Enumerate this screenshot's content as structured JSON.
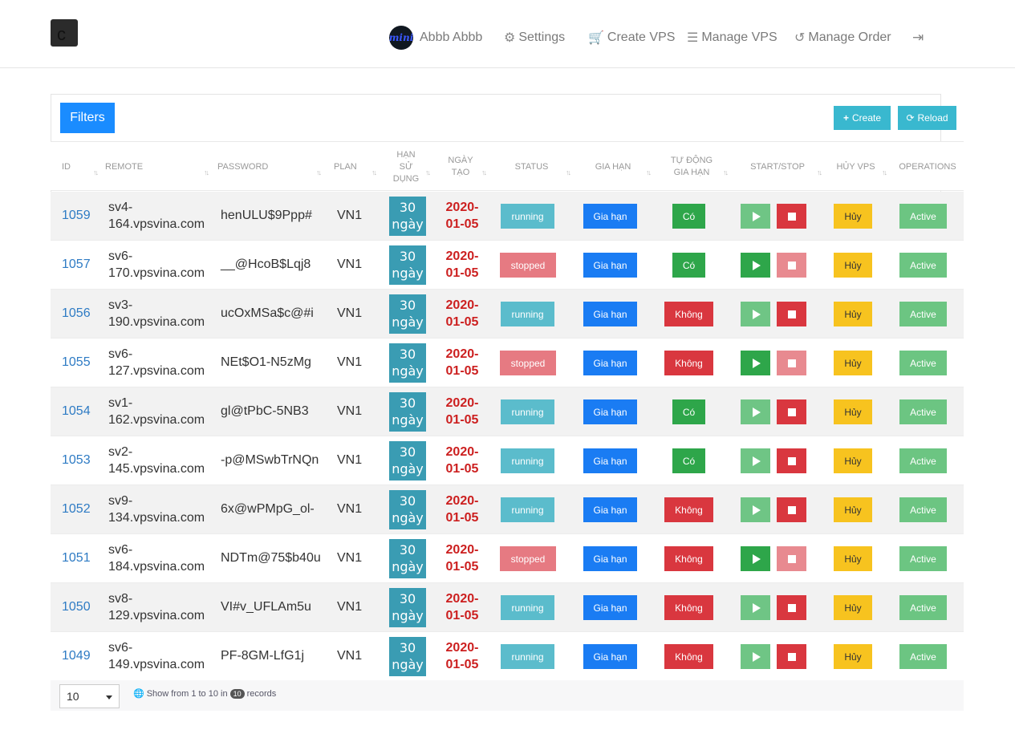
{
  "brand": {
    "logo_letter": "c"
  },
  "nav": {
    "user_name": "Abbb Abbb",
    "avatar_text": "mini",
    "settings": "Settings",
    "create_vps": "Create VPS",
    "manage_vps": "Manage VPS",
    "manage_order": "Manage Order"
  },
  "toolbar": {
    "filters": "Filters",
    "create": "Create",
    "reload": "Reload"
  },
  "columns": {
    "id": "ID",
    "remote": "REMOTE",
    "password": "PASSWORD",
    "plan": "PLAN",
    "han_su_dung_1": "HẠN",
    "han_su_dung_2": "SỬ",
    "han_su_dung_3": "DỤNG",
    "ngay_tao_1": "NGÀY",
    "ngay_tao_2": "TẠO",
    "status": "STATUS",
    "gia_han": "GIA HẠN",
    "tu_dong_1": "TỰ ĐỘNG",
    "tu_dong_2": "GIA HẠN",
    "start_stop": "START/STOP",
    "huy_vps": "HỦY VPS",
    "operations": "OPERATIONS"
  },
  "labels": {
    "days_num": "30",
    "days_unit": "ngày",
    "gia_han": "Gia hạn",
    "huy": "Hủy",
    "active": "Active",
    "yes": "Có",
    "no": "Không"
  },
  "rows": [
    {
      "id": "1059",
      "remote_1": "sv4-",
      "remote_2": "164.vpsvina.com",
      "password": "henULU$9Ppp#",
      "plan": "VN1",
      "date_1": "2020-",
      "date_2": "01-05",
      "status": "running",
      "auto": "Có"
    },
    {
      "id": "1057",
      "remote_1": "sv6-",
      "remote_2": "170.vpsvina.com",
      "password": "__@HcoB$Lqj8",
      "plan": "VN1",
      "date_1": "2020-",
      "date_2": "01-05",
      "status": "stopped",
      "auto": "Có"
    },
    {
      "id": "1056",
      "remote_1": "sv3-",
      "remote_2": "190.vpsvina.com",
      "password": "ucOxMSa$c@#i",
      "plan": "VN1",
      "date_1": "2020-",
      "date_2": "01-05",
      "status": "running",
      "auto": "Không"
    },
    {
      "id": "1055",
      "remote_1": "sv6-",
      "remote_2": "127.vpsvina.com",
      "password": "NEt$O1-N5zMg",
      "plan": "VN1",
      "date_1": "2020-",
      "date_2": "01-05",
      "status": "stopped",
      "auto": "Không"
    },
    {
      "id": "1054",
      "remote_1": "sv1-",
      "remote_2": "162.vpsvina.com",
      "password": "gl@tPbC-5NB3",
      "plan": "VN1",
      "date_1": "2020-",
      "date_2": "01-05",
      "status": "running",
      "auto": "Có"
    },
    {
      "id": "1053",
      "remote_1": "sv2-",
      "remote_2": "145.vpsvina.com",
      "password": "-p@MSwbTrNQn",
      "plan": "VN1",
      "date_1": "2020-",
      "date_2": "01-05",
      "status": "running",
      "auto": "Có"
    },
    {
      "id": "1052",
      "remote_1": "sv9-",
      "remote_2": "134.vpsvina.com",
      "password": "6x@wPMpG_ol-",
      "plan": "VN1",
      "date_1": "2020-",
      "date_2": "01-05",
      "status": "running",
      "auto": "Không"
    },
    {
      "id": "1051",
      "remote_1": "sv6-",
      "remote_2": "184.vpsvina.com",
      "password": "NDTm@75$b40u",
      "plan": "VN1",
      "date_1": "2020-",
      "date_2": "01-05",
      "status": "stopped",
      "auto": "Không"
    },
    {
      "id": "1050",
      "remote_1": "sv8-",
      "remote_2": "129.vpsvina.com",
      "password": "VI#v_UFLAm5u",
      "plan": "VN1",
      "date_1": "2020-",
      "date_2": "01-05",
      "status": "running",
      "auto": "Không"
    },
    {
      "id": "1049",
      "remote_1": "sv6-",
      "remote_2": "149.vpsvina.com",
      "password": "PF-8GM-LfG1j",
      "plan": "VN1",
      "date_1": "2020-",
      "date_2": "01-05",
      "status": "running",
      "auto": "Không"
    }
  ],
  "footer": {
    "page_size": "10",
    "show_prefix": "Show from 1 to 10 in",
    "total": "10",
    "show_suffix": "records"
  }
}
